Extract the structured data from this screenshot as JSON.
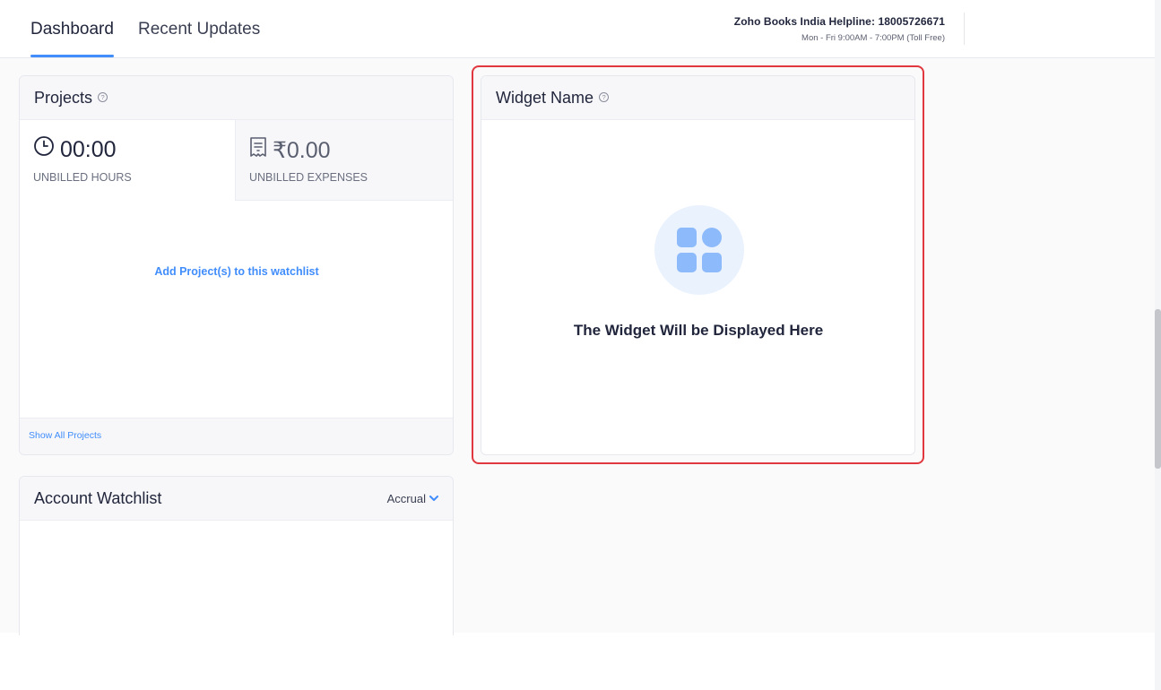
{
  "tabs": [
    {
      "label": "Dashboard",
      "active": true
    },
    {
      "label": "Recent Updates",
      "active": false
    }
  ],
  "helpline": {
    "line1": "Zoho Books India Helpline: 18005726671",
    "line2": "Mon - Fri 9:00AM - 7:00PM (Toll Free)"
  },
  "projects": {
    "title": "Projects",
    "unbilled_hours": {
      "value": "00:00",
      "label": "UNBILLED HOURS",
      "icon": "clock-icon"
    },
    "unbilled_expenses": {
      "value": "₹0.00",
      "label": "UNBILLED EXPENSES",
      "icon": "receipt-icon"
    },
    "add_link": "Add Project(s) to this watchlist",
    "show_all": "Show All Projects"
  },
  "widget": {
    "title": "Widget Name",
    "placeholder_text": "The Widget Will be Displayed Here",
    "icon": "widget-grid-icon"
  },
  "account_watchlist": {
    "title": "Account Watchlist",
    "basis": "Accrual"
  },
  "colors": {
    "accent": "#408dfb",
    "highlight": "#e0383e",
    "widget_icon": "#8dbafa",
    "widget_icon_bg": "#eaf2fe"
  }
}
